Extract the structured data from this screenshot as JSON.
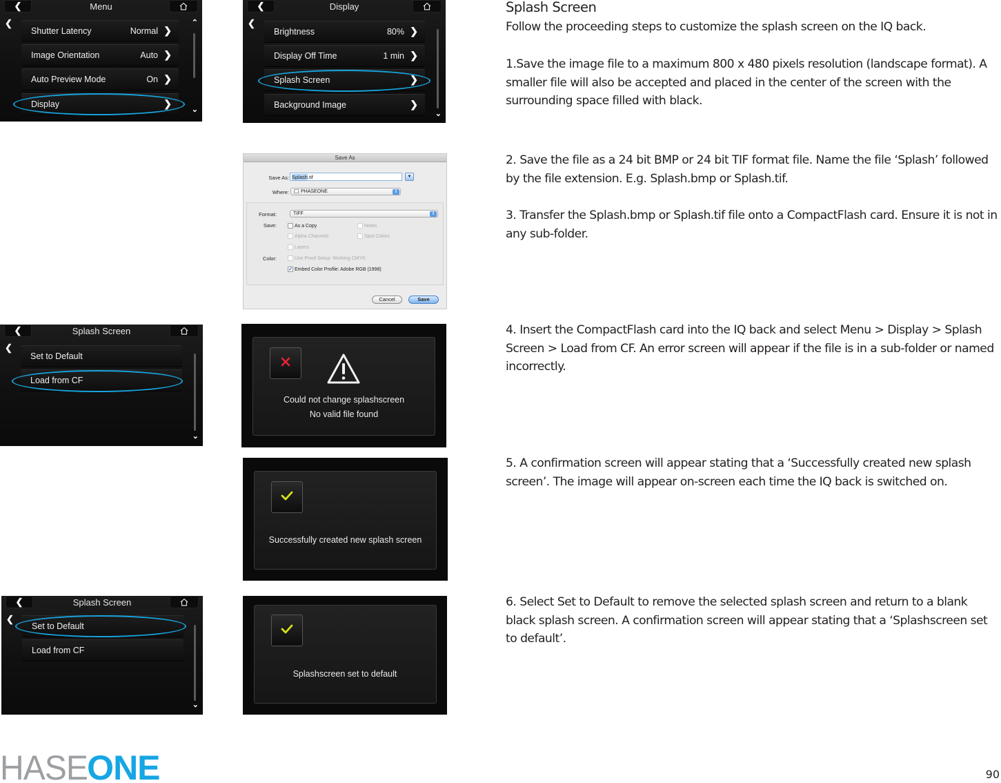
{
  "heading": "Splash Screen",
  "intro": "Follow the proceeding steps to customize the splash screen on the IQ back.",
  "steps": [
    "1.Save the image file to a maximum 800 x 480 pixels resolution (landscape format). A smaller file will also be accepted and placed in the center of the screen with the surrounding space filled with black.",
    "2. Save the file as a 24 bit BMP or 24 bit TIF format file. Name the file ‘Splash’ followed by the file extension. E.g. Splash.bmp or Splash.tif.",
    "3. Transfer the  Splash.bmp or Splash.tif file onto a CompactFlash card. Ensure it is not in any sub-folder.",
    "4. Insert the CompactFlash card into the IQ back and select Menu > Display > Splash Screen > Load from CF. An error screen will appear if the file is in a sub-folder or named incorrectly.",
    "5. A confirmation screen will appear stating that a ‘Successfully created new splash screen’. The image will appear on-screen each time the IQ back is switched on.",
    "6. Select Set to Default to remove the selected splash screen and return to a blank black splash screen. A confirmation screen will appear stating that a ‘Splashscreen set to default’."
  ],
  "screens": {
    "menu": {
      "title": "Menu",
      "items": [
        {
          "label": "Shutter Latency",
          "value": "Normal"
        },
        {
          "label": "Image Orientation",
          "value": "Auto"
        },
        {
          "label": "Auto Preview Mode",
          "value": "On"
        },
        {
          "label": "Display",
          "value": ""
        }
      ],
      "highlighted": "Display"
    },
    "display": {
      "title": "Display",
      "items": [
        {
          "label": "Brightness",
          "value": "80%"
        },
        {
          "label": "Display Off Time",
          "value": "1 min"
        },
        {
          "label": "Splash Screen",
          "value": ""
        },
        {
          "label": "Background Image",
          "value": ""
        }
      ],
      "highlighted": "Splash Screen"
    },
    "splash_a": {
      "title": "Splash Screen",
      "items": [
        {
          "label": "Set to Default"
        },
        {
          "label": "Load from CF"
        }
      ],
      "highlighted": "Load from CF"
    },
    "splash_b": {
      "title": "Splash Screen",
      "items": [
        {
          "label": "Set to Default"
        },
        {
          "label": "Load from CF"
        }
      ],
      "highlighted": "Set to Default"
    },
    "error": {
      "line1": "Could not change splashscreen",
      "line2": "No valid file found",
      "icon": "close-x-icon",
      "warning_icon": "warning-triangle-icon"
    },
    "success": {
      "line1": "Successfully created new splash screen",
      "icon": "checkmark-icon"
    },
    "default_set": {
      "line1": "Splashscreen set to default",
      "icon": "checkmark-icon"
    }
  },
  "save_dialog": {
    "title": "Save As",
    "save_as_label": "Save As:",
    "filename_selected": "Splash",
    "filename_ext": ".tif",
    "where_label": "Where:",
    "where_value": "PHASEONE",
    "format_label": "Format:",
    "format_value": "TIFF",
    "save_label": "Save:",
    "color_label": "Color:",
    "options": {
      "as_a_copy": {
        "label": "As a Copy",
        "checked": false,
        "enabled": true
      },
      "notes": {
        "label": "Notes",
        "checked": false,
        "enabled": false
      },
      "alpha_channels": {
        "label": "Alpha Channels",
        "checked": false,
        "enabled": false
      },
      "spot_colors": {
        "label": "Spot Colors",
        "checked": false,
        "enabled": false
      },
      "layers": {
        "label": "Layers",
        "checked": false,
        "enabled": false
      },
      "use_proof_setup": {
        "label": "Use Proof Setup:  Working CMYK",
        "checked": false,
        "enabled": false
      },
      "embed_color_profile": {
        "label": "Embed Color Profile:  Adobe RGB (1998)",
        "checked": true,
        "enabled": true
      }
    },
    "cancel_label": "Cancel",
    "save_button_label": "Save"
  },
  "footer": {
    "logo_thin": "HASE",
    "logo_bold": "ONE",
    "page_number": "90"
  },
  "colors": {
    "highlight": "#17a3dd",
    "logo_blue": "#16a6e3",
    "logo_gray": "#9d9fa2",
    "error_red": "#e8233a",
    "check_yellow": "#d6e21f"
  }
}
